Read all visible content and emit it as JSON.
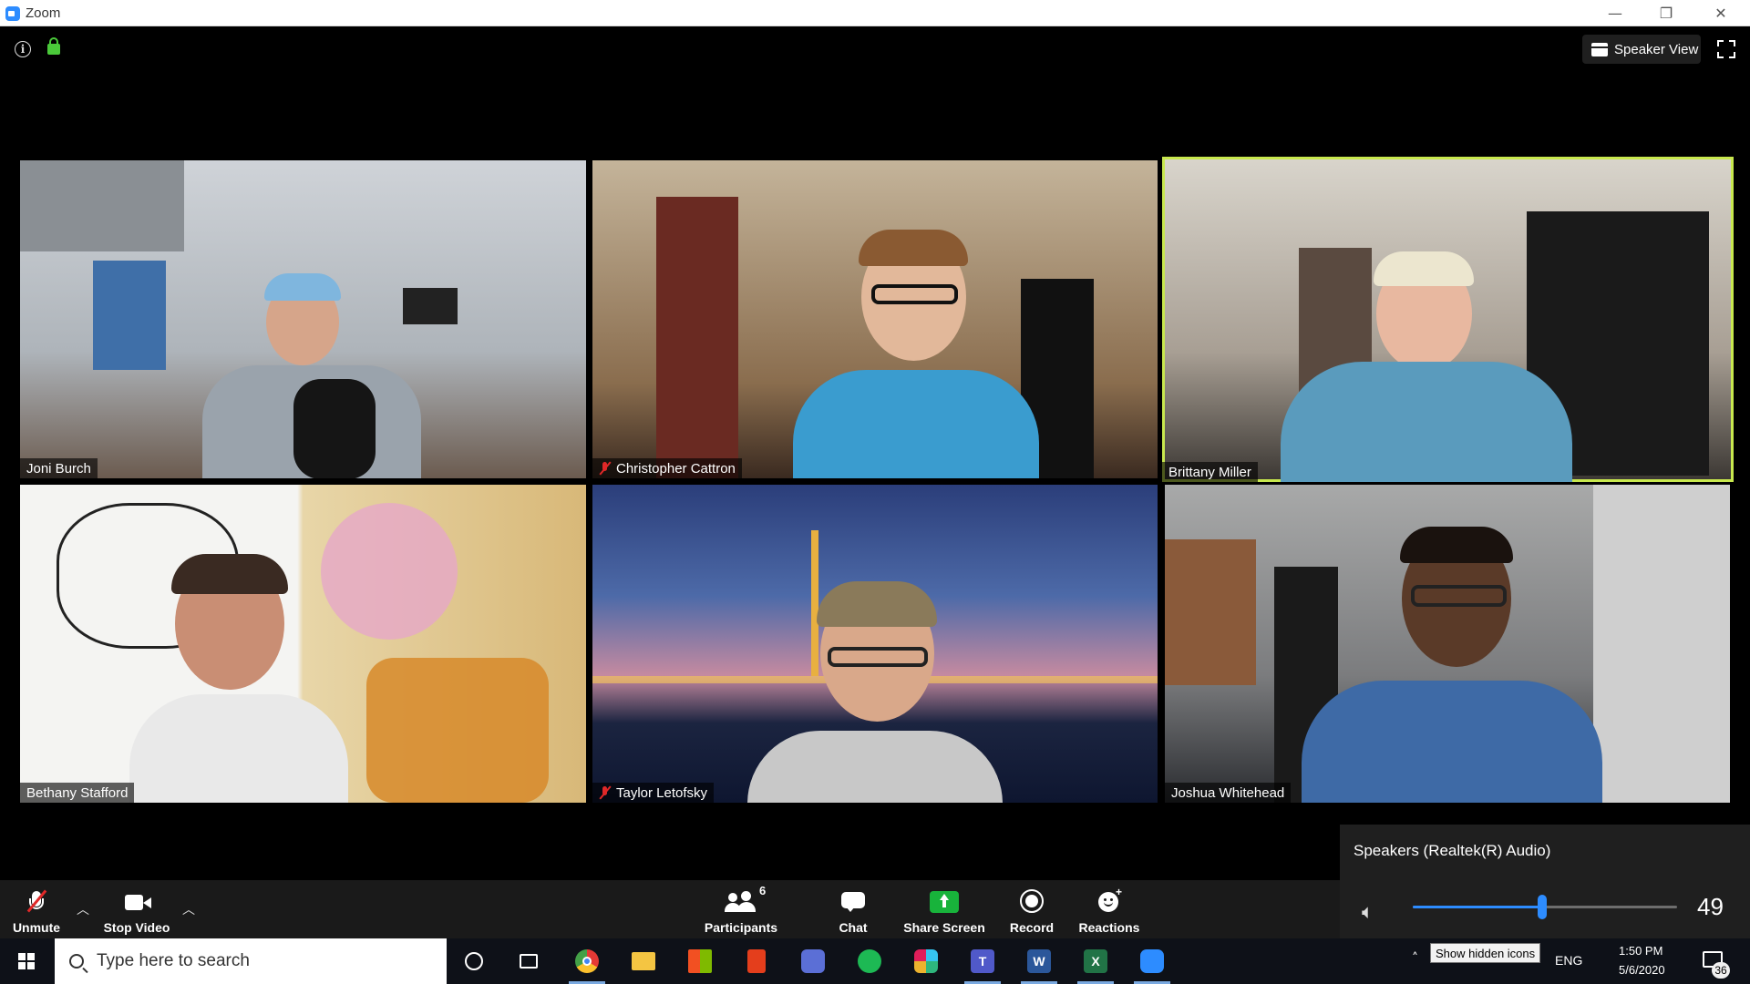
{
  "window": {
    "title": "Zoom",
    "minimize": "—",
    "restore": "❐",
    "close": "✕"
  },
  "top": {
    "speaker_view_label": "Speaker View"
  },
  "participants": [
    {
      "name": "Joni Burch",
      "muted": false,
      "active": false
    },
    {
      "name": "Christopher Cattron",
      "muted": true,
      "active": false
    },
    {
      "name": "Brittany Miller",
      "muted": false,
      "active": true
    },
    {
      "name": "Bethany Stafford",
      "muted": false,
      "active": false
    },
    {
      "name": "Taylor Letofsky",
      "muted": true,
      "active": false
    },
    {
      "name": "Joshua Whitehead",
      "muted": false,
      "active": false
    }
  ],
  "toolbar": {
    "unmute_label": "Unmute",
    "stop_video_label": "Stop Video",
    "participants_label": "Participants",
    "participants_count": "6",
    "chat_label": "Chat",
    "share_screen_label": "Share Screen",
    "record_label": "Record",
    "reactions_label": "Reactions"
  },
  "audio_popup": {
    "device_title": "Speakers (Realtek(R) Audio)",
    "volume": 49,
    "volume_text": "49"
  },
  "taskbar": {
    "search_placeholder": "Type here to search",
    "tooltip": "Show hidden icons",
    "language": "ENG",
    "time": "1:50 PM",
    "date": "5/6/2020",
    "notification_count": "36"
  },
  "colors": {
    "active_speaker": "#c8e84e",
    "muted_red": "#e02828",
    "accent_blue": "#2d8cff",
    "share_green": "#18b33b"
  }
}
